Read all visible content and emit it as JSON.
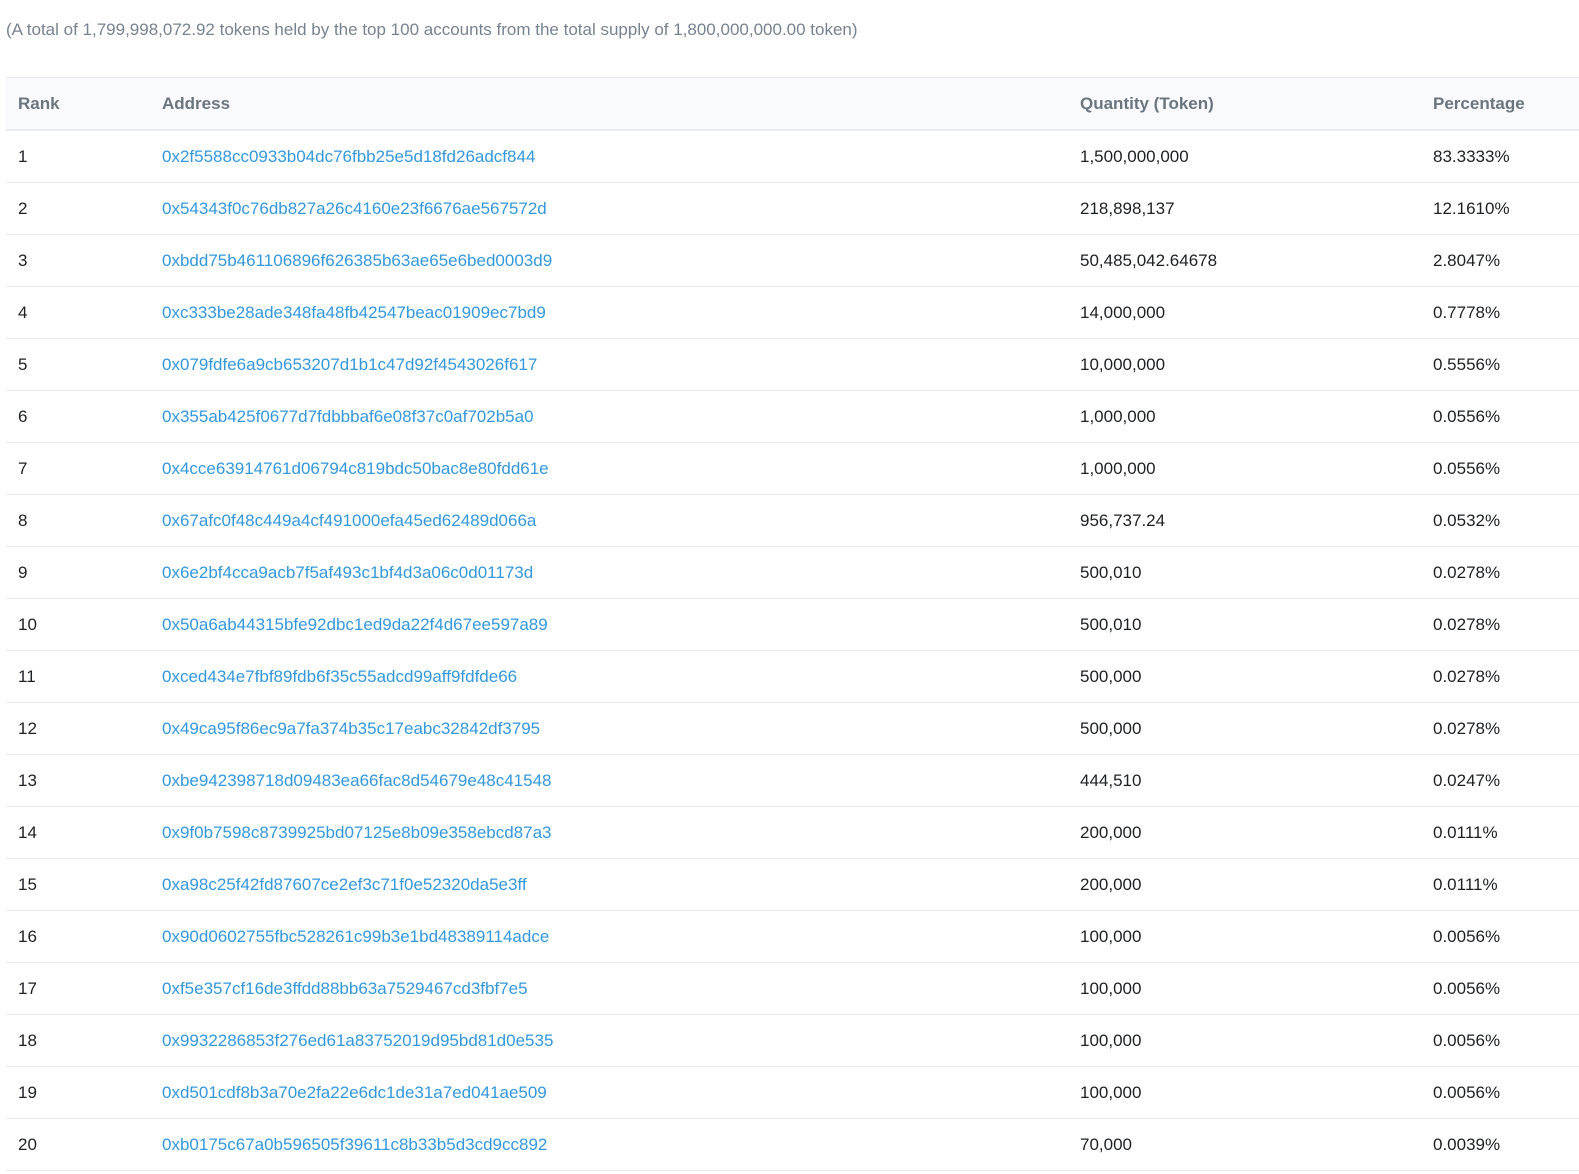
{
  "summary": "(A total of 1,799,998,072.92 tokens held by the top 100 accounts from the total supply of 1,800,000,000.00 token)",
  "table": {
    "headers": {
      "rank": "Rank",
      "address": "Address",
      "quantity": "Quantity (Token)",
      "percentage": "Percentage"
    },
    "rows": [
      {
        "rank": "1",
        "address": "0x2f5588cc0933b04dc76fbb25e5d18fd26adcf844",
        "quantity": "1,500,000,000",
        "percentage": "83.3333%"
      },
      {
        "rank": "2",
        "address": "0x54343f0c76db827a26c4160e23f6676ae567572d",
        "quantity": "218,898,137",
        "percentage": "12.1610%"
      },
      {
        "rank": "3",
        "address": "0xbdd75b461106896f626385b63ae65e6bed0003d9",
        "quantity": "50,485,042.64678",
        "percentage": "2.8047%"
      },
      {
        "rank": "4",
        "address": "0xc333be28ade348fa48fb42547beac01909ec7bd9",
        "quantity": "14,000,000",
        "percentage": "0.7778%"
      },
      {
        "rank": "5",
        "address": "0x079fdfe6a9cb653207d1b1c47d92f4543026f617",
        "quantity": "10,000,000",
        "percentage": "0.5556%"
      },
      {
        "rank": "6",
        "address": "0x355ab425f0677d7fdbbbaf6e08f37c0af702b5a0",
        "quantity": "1,000,000",
        "percentage": "0.0556%"
      },
      {
        "rank": "7",
        "address": "0x4cce63914761d06794c819bdc50bac8e80fdd61e",
        "quantity": "1,000,000",
        "percentage": "0.0556%"
      },
      {
        "rank": "8",
        "address": "0x67afc0f48c449a4cf491000efa45ed62489d066a",
        "quantity": "956,737.24",
        "percentage": "0.0532%"
      },
      {
        "rank": "9",
        "address": "0x6e2bf4cca9acb7f5af493c1bf4d3a06c0d01173d",
        "quantity": "500,010",
        "percentage": "0.0278%"
      },
      {
        "rank": "10",
        "address": "0x50a6ab44315bfe92dbc1ed9da22f4d67ee597a89",
        "quantity": "500,010",
        "percentage": "0.0278%"
      },
      {
        "rank": "11",
        "address": "0xced434e7fbf89fdb6f35c55adcd99aff9fdfde66",
        "quantity": "500,000",
        "percentage": "0.0278%"
      },
      {
        "rank": "12",
        "address": "0x49ca95f86ec9a7fa374b35c17eabc32842df3795",
        "quantity": "500,000",
        "percentage": "0.0278%"
      },
      {
        "rank": "13",
        "address": "0xbe942398718d09483ea66fac8d54679e48c41548",
        "quantity": "444,510",
        "percentage": "0.0247%"
      },
      {
        "rank": "14",
        "address": "0x9f0b7598c8739925bd07125e8b09e358ebcd87a3",
        "quantity": "200,000",
        "percentage": "0.0111%"
      },
      {
        "rank": "15",
        "address": "0xa98c25f42fd87607ce2ef3c71f0e52320da5e3ff",
        "quantity": "200,000",
        "percentage": "0.0111%"
      },
      {
        "rank": "16",
        "address": "0x90d0602755fbc528261c99b3e1bd48389114adce",
        "quantity": "100,000",
        "percentage": "0.0056%"
      },
      {
        "rank": "17",
        "address": "0xf5e357cf16de3ffdd88bb63a7529467cd3fbf7e5",
        "quantity": "100,000",
        "percentage": "0.0056%"
      },
      {
        "rank": "18",
        "address": "0x9932286853f276ed61a83752019d95bd81d0e535",
        "quantity": "100,000",
        "percentage": "0.0056%"
      },
      {
        "rank": "19",
        "address": "0xd501cdf8b3a70e2fa22e6dc1de31a7ed041ae509",
        "quantity": "100,000",
        "percentage": "0.0056%"
      },
      {
        "rank": "20",
        "address": "0xb0175c67a0b596505f39611c8b33b5d3cd9cc892",
        "quantity": "70,000",
        "percentage": "0.0039%"
      }
    ]
  },
  "colors": {
    "link": "#3498db",
    "header_bg": "#f8fafd",
    "border": "#e7eaf3",
    "muted_text": "#77838f"
  }
}
